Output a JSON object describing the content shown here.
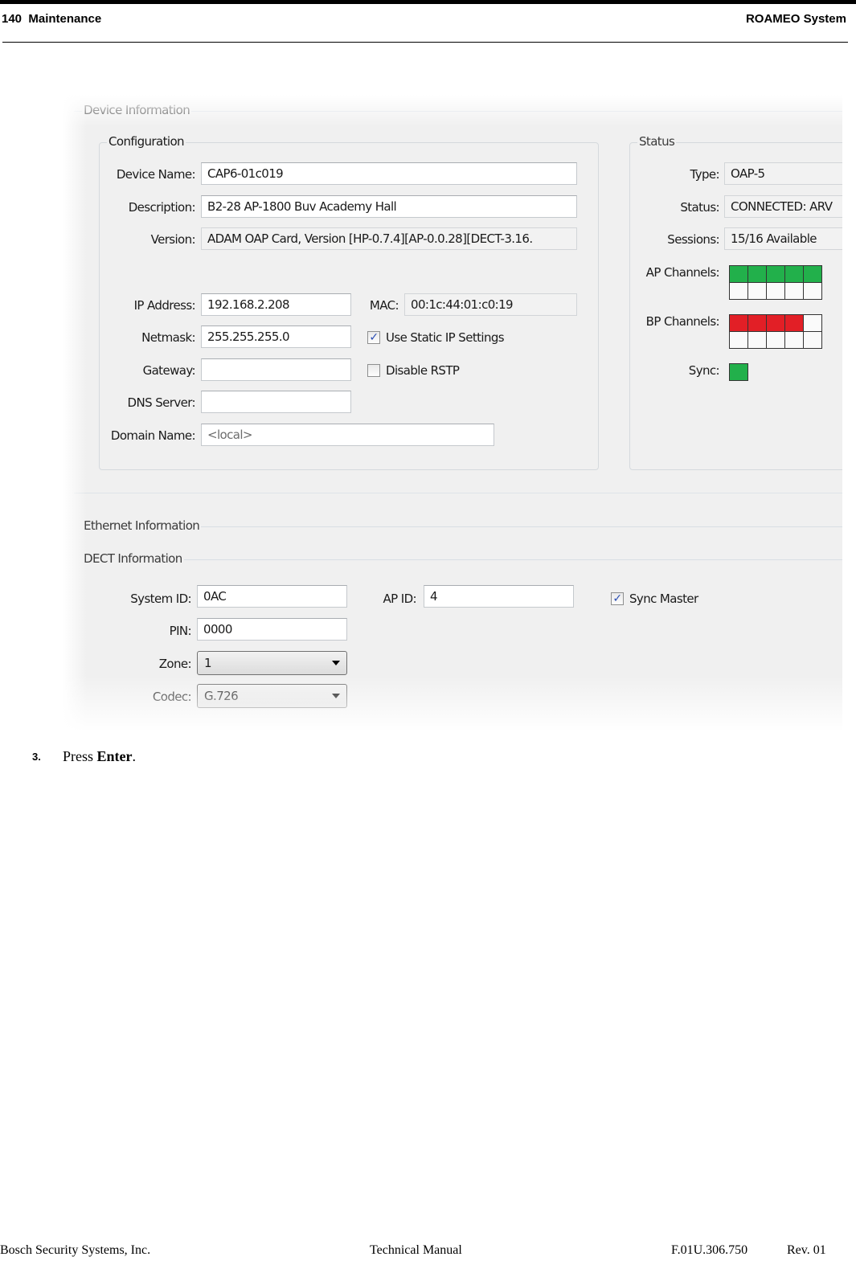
{
  "page_header": {
    "left": "140  Maintenance",
    "right": "ROAMEO System"
  },
  "screenshot": {
    "device_information": {
      "title": "Device Information",
      "configuration": {
        "title": "Configuration",
        "device_name": {
          "label": "Device Name:",
          "value": "CAP6-01c019"
        },
        "description": {
          "label": "Description:",
          "value": "B2-28 AP-1800 Buv Academy Hall"
        },
        "version": {
          "label": "Version:",
          "value": "ADAM OAP Card, Version [HP-0.7.4][AP-0.0.28][DECT-3.16."
        },
        "ip_address": {
          "label": "IP Address:",
          "value": "192.168.2.208"
        },
        "mac": {
          "label": "MAC:",
          "value": "00:1c:44:01:c0:19"
        },
        "netmask": {
          "label": "Netmask:",
          "value": "255.255.255.0"
        },
        "use_static_ip": {
          "label": "Use Static IP Settings",
          "checked": true
        },
        "gateway": {
          "label": "Gateway:",
          "value": ""
        },
        "disable_rstp": {
          "label": "Disable RSTP",
          "checked": false
        },
        "dns_server": {
          "label": "DNS Server:",
          "value": ""
        },
        "domain_name": {
          "label": "Domain Name:",
          "placeholder": "<local>"
        }
      },
      "status": {
        "title": "Status",
        "type": {
          "label": "Type:",
          "value": "OAP-5"
        },
        "status": {
          "label": "Status:",
          "value": "CONNECTED: ARV"
        },
        "sessions": {
          "label": "Sessions:",
          "value": "15/16 Available"
        },
        "ap_channels": {
          "label": "AP Channels:",
          "total": 10,
          "active": 5,
          "active_color": "#22b04b"
        },
        "bp_channels": {
          "label": "BP Channels:",
          "total": 10,
          "active": 4,
          "active_color": "#e21f26"
        },
        "sync": {
          "label": "Sync:",
          "state": "on",
          "color": "#22b04b"
        }
      }
    },
    "ethernet_information": {
      "title": "Ethernet Information"
    },
    "dect_information": {
      "title": "DECT Information",
      "system_id": {
        "label": "System ID:",
        "value": "0AC"
      },
      "ap_id": {
        "label": "AP ID:",
        "value": "4"
      },
      "sync_master": {
        "label": "Sync Master",
        "checked": true
      },
      "pin": {
        "label": "PIN:",
        "value": "0000"
      },
      "zone": {
        "label": "Zone:",
        "value": "1"
      },
      "codec": {
        "label": "Codec:",
        "value": "G.726"
      }
    }
  },
  "instruction": {
    "number": "3.",
    "prefix": "Press ",
    "key": "Enter",
    "suffix": "."
  },
  "page_footer": {
    "company": "Bosch Security Systems, Inc.",
    "doc_type": "Technical Manual",
    "doc_number": "F.01U.306.750",
    "revision": "Rev. 01"
  }
}
